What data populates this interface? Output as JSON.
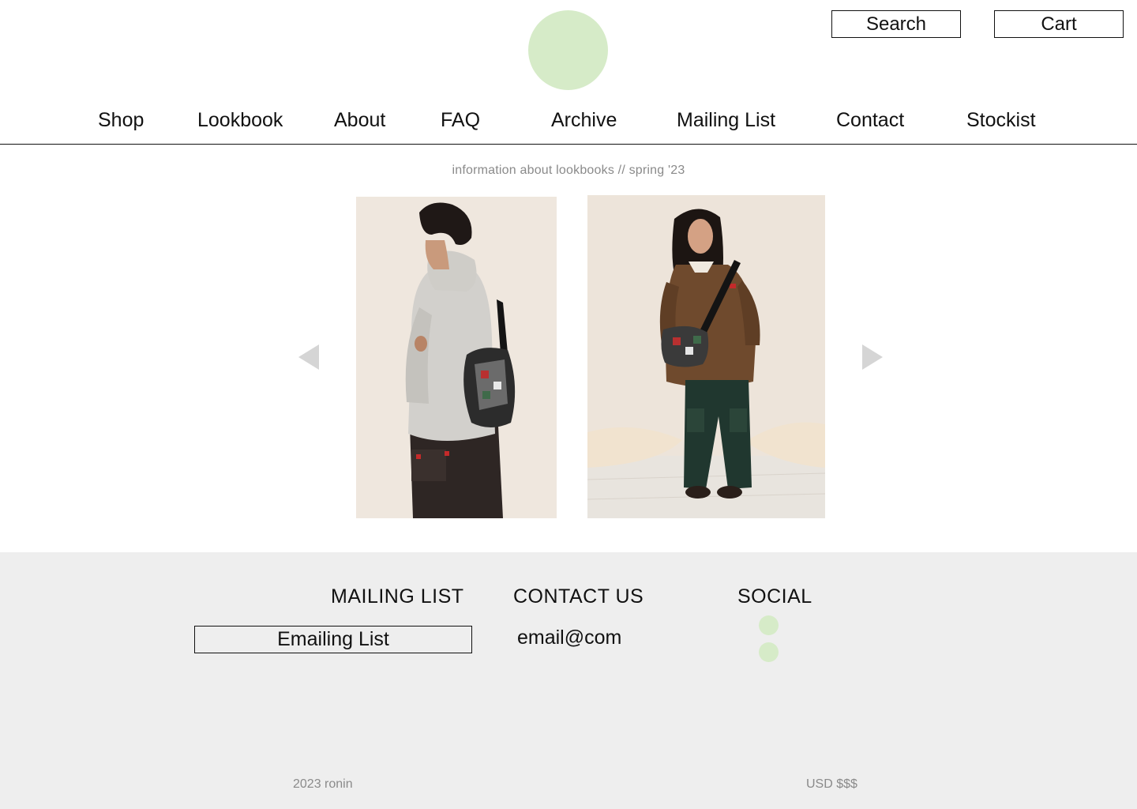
{
  "header": {
    "logo_icon": "circle-logo",
    "search_label": "Search",
    "cart_label": "Cart"
  },
  "nav": {
    "items": [
      {
        "label": "Shop"
      },
      {
        "label": "Lookbook"
      },
      {
        "label": "About"
      },
      {
        "label": "FAQ"
      },
      {
        "label": "Archive"
      },
      {
        "label": "Mailing List"
      },
      {
        "label": "Contact"
      },
      {
        "label": "Stockist"
      }
    ]
  },
  "lookbook": {
    "subtitle": "information about lookbooks // spring '23",
    "prev_icon": "triangle-left-icon",
    "next_icon": "triangle-right-icon"
  },
  "footer": {
    "mailing_heading": "MAILING LIST",
    "mailing_input_value": "Emailing List",
    "contact_heading": "CONTACT US",
    "contact_email": "email@com",
    "social_heading": "SOCIAL",
    "copyright": "2023 ronin",
    "currency": "USD $$$"
  },
  "colors": {
    "accent_green": "#d6ebc8",
    "footer_bg": "#eeeeee",
    "muted_text": "#8a8a8a",
    "arrow_gray": "#d5d5d5"
  }
}
